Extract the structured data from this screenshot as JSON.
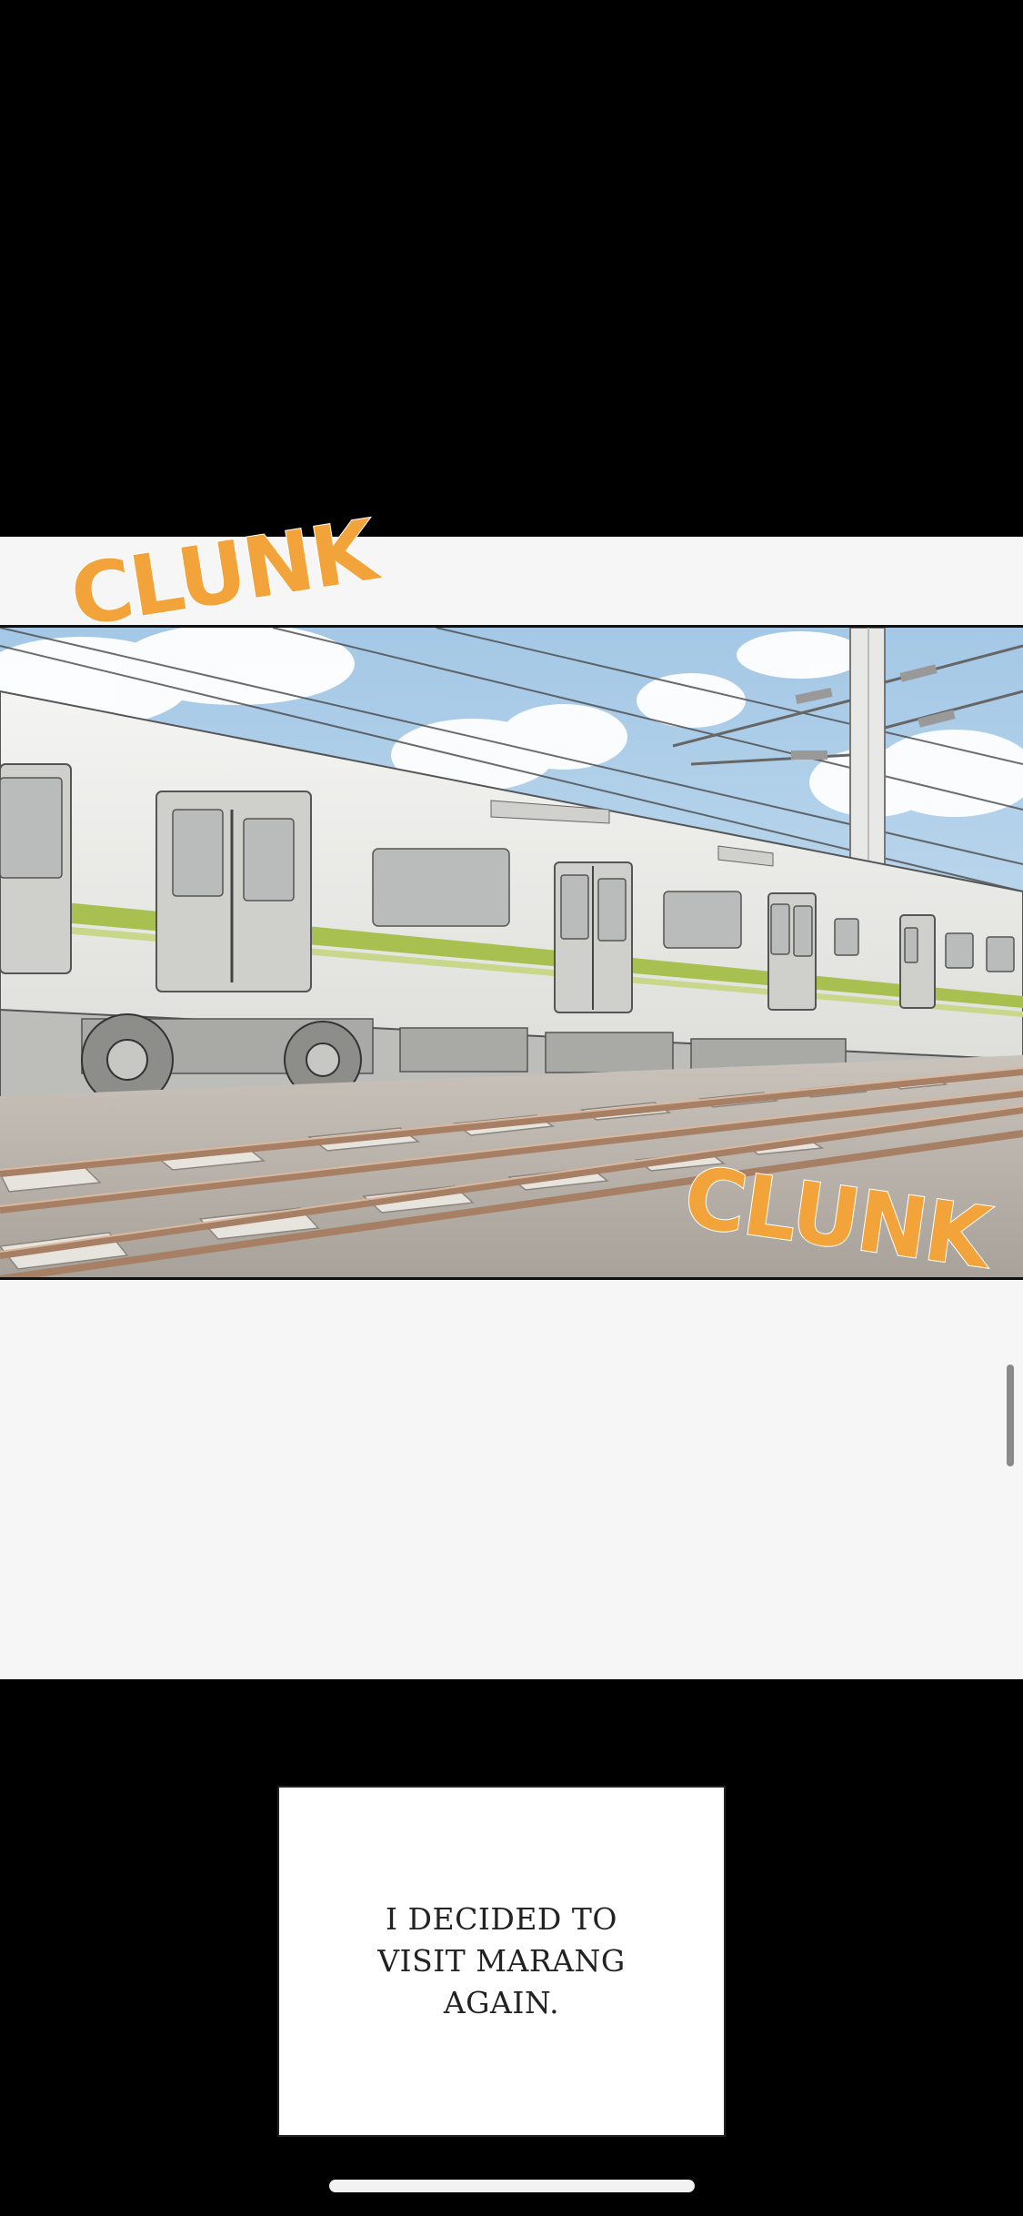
{
  "comic": {
    "sound_effects": [
      "CLUNK",
      "CLUNK"
    ],
    "caption": "I DECIDED TO\nVISIT MARANG\nAGAIN."
  },
  "colors": {
    "background": "#000000",
    "strip": "#f6f6f6",
    "sfx": "#f2a33a",
    "train_stripe": "#a8c050",
    "sky": "#a9cde8"
  },
  "icons": {
    "scroll_indicator": "scrollbar-thumb",
    "home_indicator": "home-bar"
  }
}
